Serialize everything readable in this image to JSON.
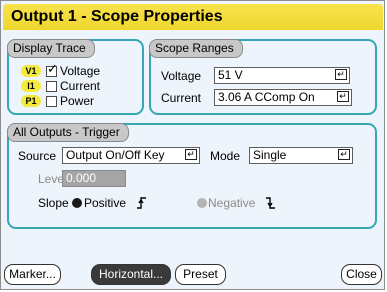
{
  "window": {
    "title": "Output 1 - Scope Properties"
  },
  "display_trace": {
    "label": "Display Trace",
    "items": [
      {
        "badge": "V1",
        "label": "Voltage",
        "checked": true
      },
      {
        "badge": "I1",
        "label": "Current",
        "checked": false
      },
      {
        "badge": "P1",
        "label": "Power",
        "checked": false
      }
    ]
  },
  "scope_ranges": {
    "label": "Scope Ranges",
    "voltage_label": "Voltage",
    "voltage_value": "51 V",
    "current_label": "Current",
    "current_value": "3.06 A CComp On"
  },
  "trigger": {
    "label": "All Outputs - Trigger",
    "source_label": "Source",
    "source_value": "Output On/Off Key",
    "mode_label": "Mode",
    "mode_value": "Single",
    "level_label": "Level",
    "level_value": "0.000",
    "slope_label": "Slope",
    "positive_label": "Positive",
    "negative_label": "Negative",
    "selected_slope": "Positive"
  },
  "buttons": {
    "marker": "Marker...",
    "horizontal": "Horizontal...",
    "preset": "Preset",
    "close": "Close"
  },
  "colors": {
    "title_bar": "#f0d93a",
    "group_border": "#35a7b5",
    "badge": "#f3ea3c",
    "selected_button": "#3a3a3a"
  },
  "icons": {
    "enter": "enter-key-icon",
    "rising_edge": "rising-edge-icon",
    "falling_edge": "falling-edge-icon"
  }
}
